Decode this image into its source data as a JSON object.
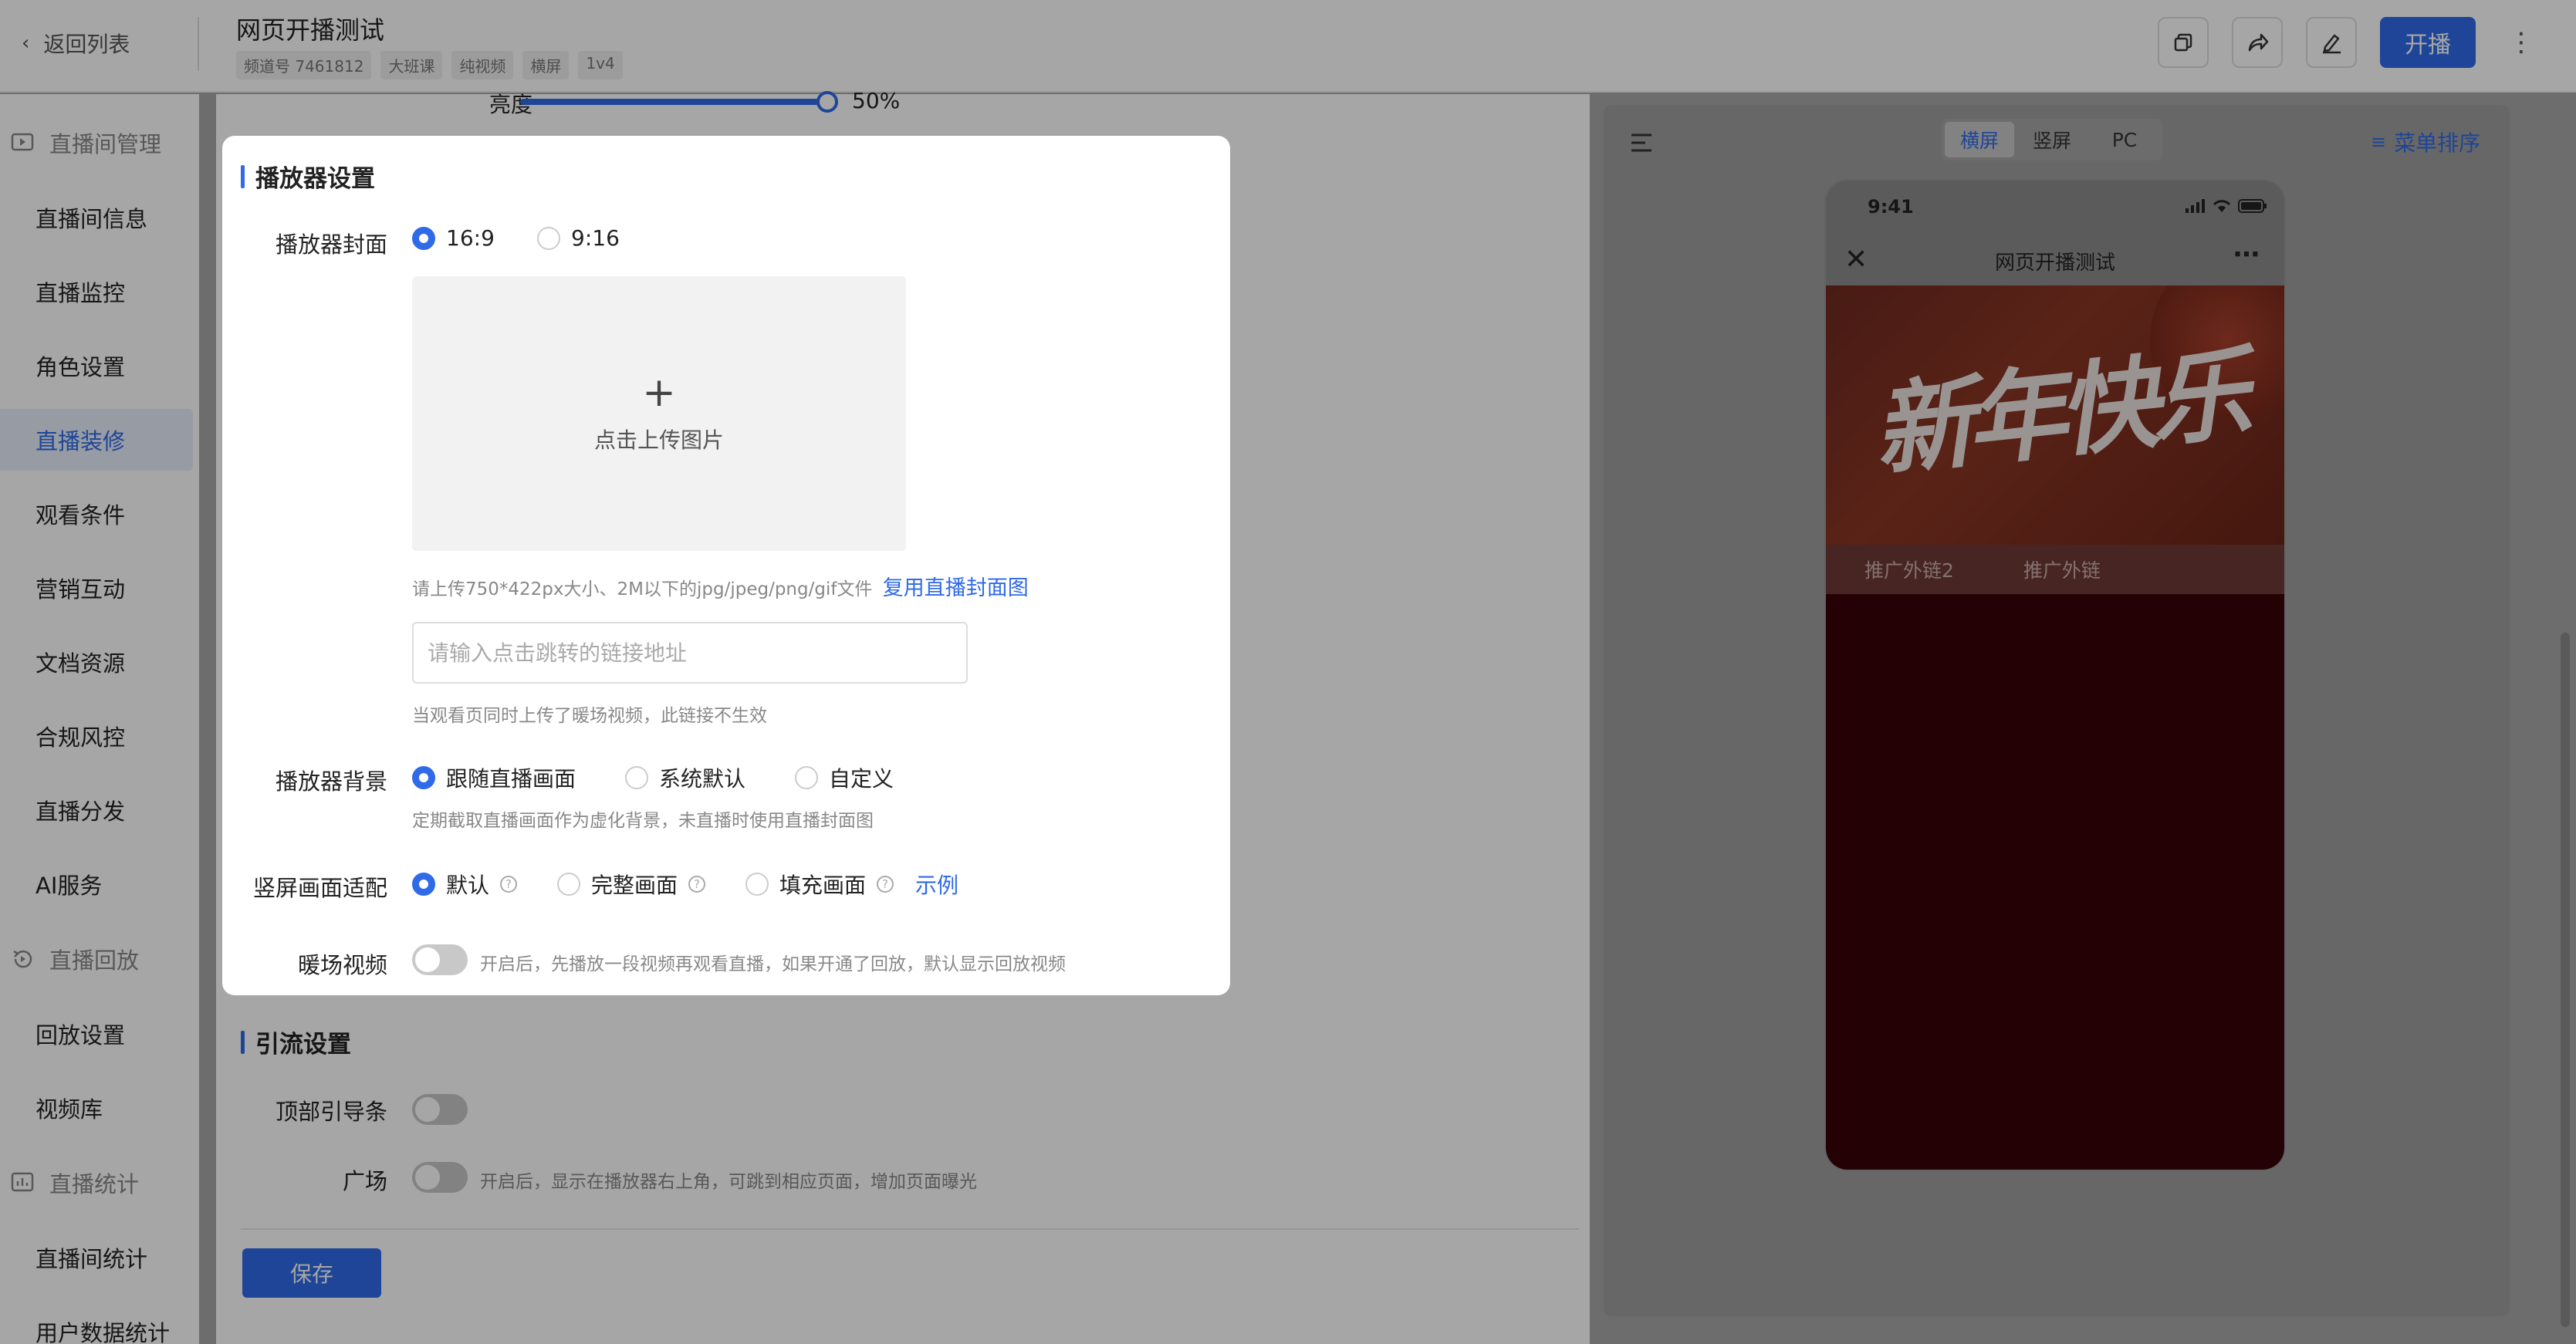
{
  "header": {
    "back_label": "返回列表",
    "title": "网页开播测试",
    "tags": [
      "频道号 7461812",
      "大班课",
      "纯视频",
      "横屏",
      "1v4"
    ],
    "live_button": "开播",
    "icons": [
      "copy-icon",
      "share-icon",
      "edit-icon",
      "more-icon"
    ]
  },
  "sidebar": {
    "groups": [
      {
        "label": "直播间管理",
        "icon": "play-icon",
        "items": [
          "直播间信息",
          "直播监控",
          "角色设置",
          "直播装修",
          "观看条件",
          "营销互动",
          "文档资源",
          "合规风控",
          "直播分发",
          "AI服务"
        ]
      },
      {
        "label": "直播回放",
        "icon": "replay-icon",
        "items": [
          "回放设置",
          "视频库"
        ]
      },
      {
        "label": "直播统计",
        "icon": "stats-icon",
        "items": [
          "直播间统计",
          "用户数据统计"
        ]
      }
    ],
    "active_item": "直播装修"
  },
  "brightness": {
    "label": "亮度",
    "value": "50%",
    "level": 0.5
  },
  "player_settings": {
    "title": "播放器设置",
    "cover_label": "播放器封面",
    "cover_options": [
      "16:9",
      "9:16"
    ],
    "cover_selected": "16:9",
    "upload_text": "点击上传图片",
    "upload_hint": "请上传750*422px大小、2M以下的jpg/jpeg/png/gif文件",
    "reuse_link": "复用直播封面图",
    "link_placeholder": "请输入点击跳转的链接地址",
    "link_hint": "当观看页同时上传了暖场视频，此链接不生效",
    "bg_label": "播放器背景",
    "bg_options": [
      "跟随直播画面",
      "系统默认",
      "自定义"
    ],
    "bg_selected": "跟随直播画面",
    "bg_hint": "定期截取直播画面作为虚化背景，未直播时使用直播封面图",
    "fit_label": "竖屏画面适配",
    "fit_options": [
      "默认",
      "完整画面",
      "填充画面"
    ],
    "fit_selected": "默认",
    "fit_example": "示例",
    "warmup_label": "暖场视频",
    "warmup_enabled": false,
    "warmup_hint": "开启后，先播放一段视频再观看直播，如果开通了回放，默认显示回放视频"
  },
  "traffic_settings": {
    "title": "引流设置",
    "top_bar_label": "顶部引导条",
    "top_bar_enabled": false,
    "plaza_label": "广场",
    "plaza_enabled": false,
    "plaza_hint": "开启后，显示在播放器右上角，可跳到相应页面，增加页面曝光"
  },
  "save_button": "保存",
  "preview": {
    "tabs": [
      "横屏",
      "竖屏",
      "PC"
    ],
    "active_tab": "横屏",
    "menu_sort": "菜单排序",
    "phone_time": "9:41",
    "phone_title": "网页开播测试",
    "video_text": "新年快乐",
    "video_tabs": [
      "推广外链2",
      "推广外链"
    ]
  },
  "colors": {
    "accent": "#2f6ae8",
    "phone_body": "#5c0b14"
  }
}
